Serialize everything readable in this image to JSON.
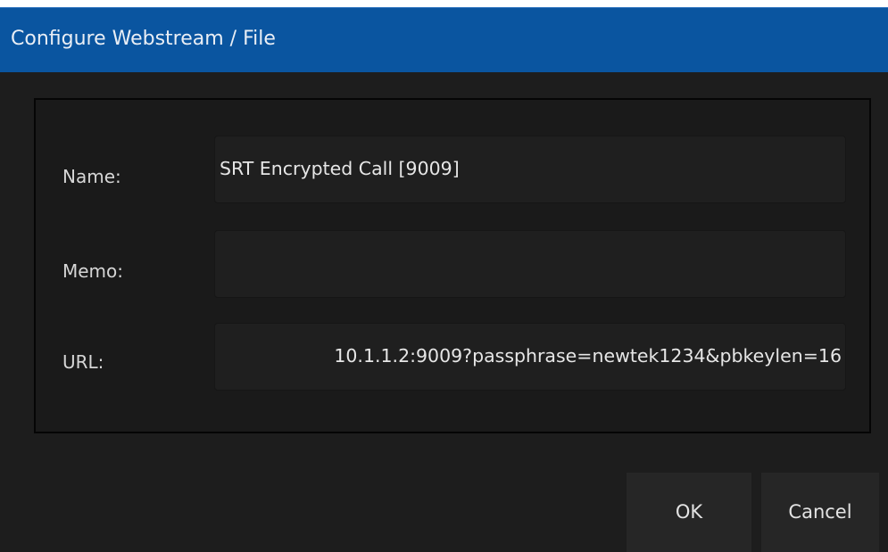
{
  "dialog": {
    "title": "Configure Webstream / File"
  },
  "form": {
    "name": {
      "label": "Name:",
      "value": "SRT Encrypted Call [9009]"
    },
    "memo": {
      "label": "Memo:",
      "value": ""
    },
    "url": {
      "label": "URL:",
      "value": "10.1.1.2:9009?passphrase=newtek1234&pbkeylen=16"
    }
  },
  "buttons": {
    "ok": "OK",
    "cancel": "Cancel"
  },
  "colors": {
    "titlebar": "#0a55a0",
    "background": "#1d1d1d",
    "panel": "#1a1a1a",
    "button": "#262626"
  }
}
